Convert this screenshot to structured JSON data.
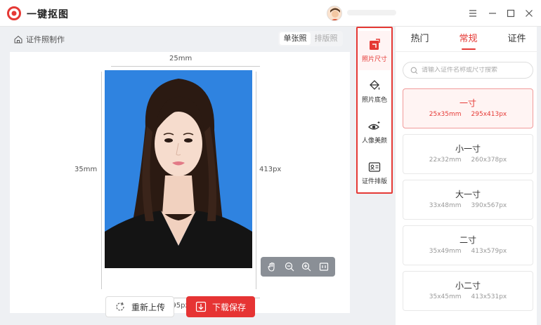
{
  "app": {
    "title": "一键抠图"
  },
  "left": {
    "header": "证件照制作",
    "mode_single": "单张照",
    "mode_layout": "排版照"
  },
  "canvas": {
    "dim_top": "25mm",
    "dim_left": "35mm",
    "dim_right": "413px",
    "dim_bottom": "295px"
  },
  "actions": {
    "reupload": "重新上传",
    "save": "下载保存"
  },
  "tools": [
    {
      "label": "照片尺寸",
      "icon": "crop-icon"
    },
    {
      "label": "照片底色",
      "icon": "paint-bucket-icon"
    },
    {
      "label": "人像美颜",
      "icon": "eye-sparkle-icon"
    },
    {
      "label": "证件排版",
      "icon": "id-card-icon"
    }
  ],
  "right": {
    "tabs": [
      "热门",
      "常规",
      "证件"
    ],
    "active_tab": "常规",
    "search_placeholder": "请输入证件名称或尺寸搜索",
    "sizes": [
      {
        "name": "一寸",
        "mm": "25x35mm",
        "px": "295x413px"
      },
      {
        "name": "小一寸",
        "mm": "22x32mm",
        "px": "260x378px"
      },
      {
        "name": "大一寸",
        "mm": "33x48mm",
        "px": "390x567px"
      },
      {
        "name": "二寸",
        "mm": "35x49mm",
        "px": "413x579px"
      },
      {
        "name": "小二寸",
        "mm": "35x45mm",
        "px": "413x531px"
      }
    ]
  },
  "colors": {
    "accent": "#e53935",
    "photo_background": "#2f83e0"
  }
}
